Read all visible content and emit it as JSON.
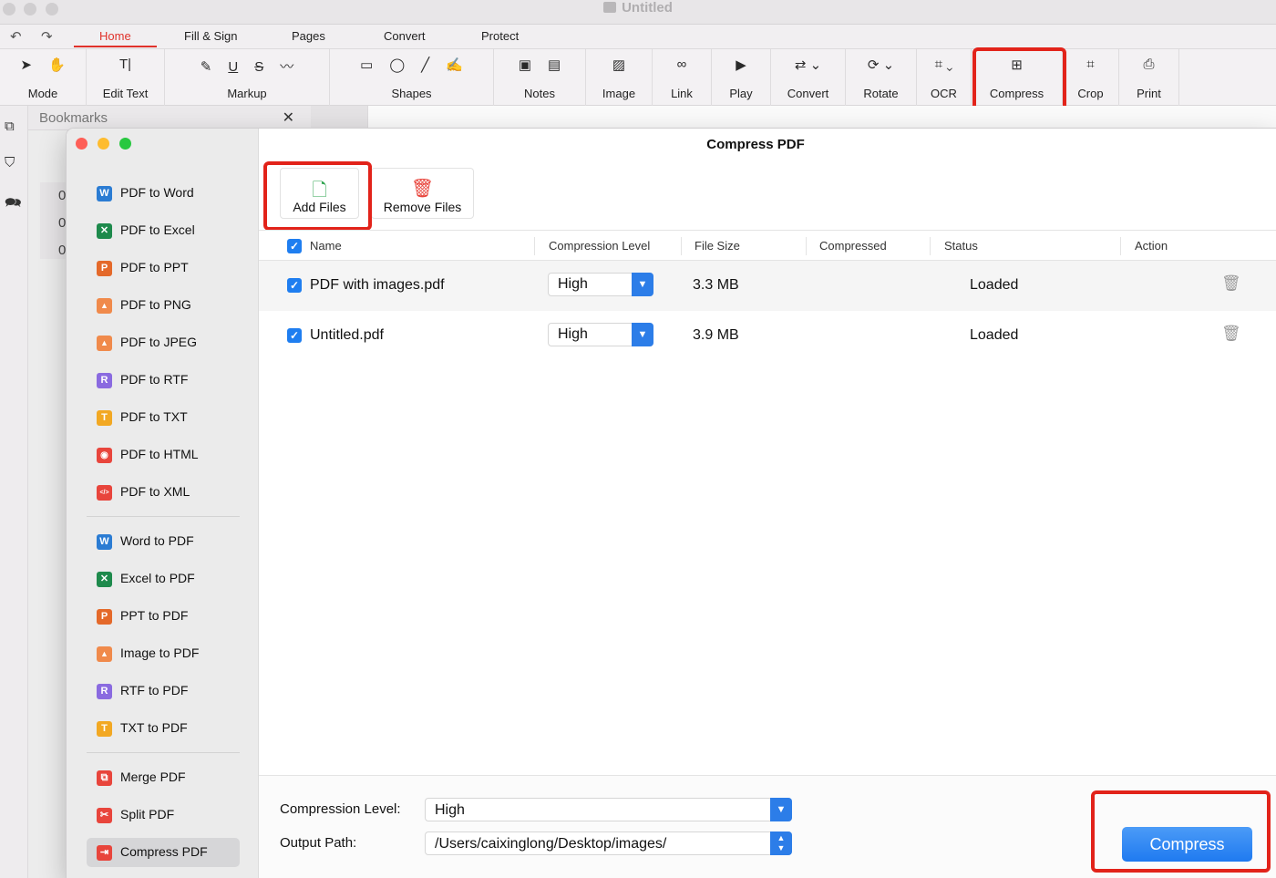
{
  "window": {
    "title": "Untitled"
  },
  "menu_tabs": [
    "Home",
    "Fill & Sign",
    "Pages",
    "Convert",
    "Protect"
  ],
  "toolbar": {
    "groups": [
      {
        "label": "Mode",
        "icons": [
          "pointer-icon",
          "hand-icon"
        ]
      },
      {
        "label": "Edit Text",
        "icons": [
          "text-cursor-icon"
        ]
      },
      {
        "label": "Markup",
        "icons": [
          "highlight-icon",
          "underline-icon",
          "strikethrough-icon",
          "marker-icon"
        ]
      },
      {
        "label": "Shapes",
        "icons": [
          "rectangle-icon",
          "ellipse-icon",
          "line-icon",
          "pencil-icon"
        ]
      },
      {
        "label": "Notes",
        "icons": [
          "textbox-icon",
          "comment-icon"
        ]
      },
      {
        "label": "Image",
        "icons": [
          "image-add-icon"
        ]
      },
      {
        "label": "Link",
        "icons": [
          "link-icon"
        ]
      },
      {
        "label": "Play",
        "icons": [
          "play-icon"
        ]
      },
      {
        "label": "Convert",
        "icons": [
          "convert-icon"
        ]
      },
      {
        "label": "Rotate",
        "icons": [
          "rotate-icon"
        ]
      },
      {
        "label": "OCR",
        "icons": [
          "ocr-icon"
        ]
      },
      {
        "label": "Compress",
        "icons": [
          "compress-icon"
        ]
      },
      {
        "label": "Crop",
        "icons": [
          "crop-icon"
        ]
      },
      {
        "label": "Print",
        "icons": [
          "print-icon"
        ]
      }
    ]
  },
  "left_panel": {
    "title": "Bookmarks",
    "page_numbers": [
      "0",
      "0",
      "0"
    ]
  },
  "dialog": {
    "title": "Compress PDF",
    "sidebar": {
      "convert_from_pdf": [
        {
          "label": "PDF to Word",
          "badge": "W",
          "color": "#2b7cd3"
        },
        {
          "label": "PDF to Excel",
          "badge": "✕",
          "color": "#1e8a4c"
        },
        {
          "label": "PDF to PPT",
          "badge": "P",
          "color": "#e4692a"
        },
        {
          "label": "PDF to PNG",
          "badge": "▲",
          "color": "#f08a4b"
        },
        {
          "label": "PDF to JPEG",
          "badge": "▲",
          "color": "#f08a4b"
        },
        {
          "label": "PDF to RTF",
          "badge": "R",
          "color": "#8a6ae0"
        },
        {
          "label": "PDF to TXT",
          "badge": "T",
          "color": "#f2a823"
        },
        {
          "label": "PDF to HTML",
          "badge": "◉",
          "color": "#e8453c"
        },
        {
          "label": "PDF to XML",
          "badge": "</>",
          "color": "#e8453c"
        }
      ],
      "convert_to_pdf": [
        {
          "label": "Word to PDF",
          "badge": "W",
          "color": "#2b7cd3"
        },
        {
          "label": "Excel to PDF",
          "badge": "✕",
          "color": "#1e8a4c"
        },
        {
          "label": "PPT to PDF",
          "badge": "P",
          "color": "#e4692a"
        },
        {
          "label": "Image to PDF",
          "badge": "▲",
          "color": "#f08a4b"
        },
        {
          "label": "RTF to PDF",
          "badge": "R",
          "color": "#8a6ae0"
        },
        {
          "label": "TXT to PDF",
          "badge": "T",
          "color": "#f2a823"
        }
      ],
      "tools": [
        {
          "label": "Merge PDF",
          "badge": "⧉",
          "color": "#e8453c"
        },
        {
          "label": "Split PDF",
          "badge": "✂",
          "color": "#e8453c"
        },
        {
          "label": "Compress PDF",
          "badge": "⇥",
          "color": "#e8453c",
          "active": true
        }
      ]
    },
    "actions": {
      "add_files": "Add Files",
      "remove_files": "Remove Files"
    },
    "table": {
      "columns": [
        "Name",
        "Compression Level",
        "File Size",
        "Compressed",
        "Status",
        "Action"
      ],
      "rows": [
        {
          "checked": true,
          "name": "PDF with images.pdf",
          "level": "High",
          "size": "3.3 MB",
          "compressed": "",
          "status": "Loaded"
        },
        {
          "checked": true,
          "name": "Untitled.pdf",
          "level": "High",
          "size": "3.9 MB",
          "compressed": "",
          "status": "Loaded"
        }
      ]
    },
    "footer": {
      "compression_label": "Compression Level:",
      "compression_value": "High",
      "output_label": "Output Path:",
      "output_value": "/Users/caixinglong/Desktop/images/",
      "compress_button": "Compress"
    }
  },
  "colors": {
    "accent": "#1f7ef0",
    "highlight_box": "#e2231a",
    "active_tab": "#e0322b"
  }
}
